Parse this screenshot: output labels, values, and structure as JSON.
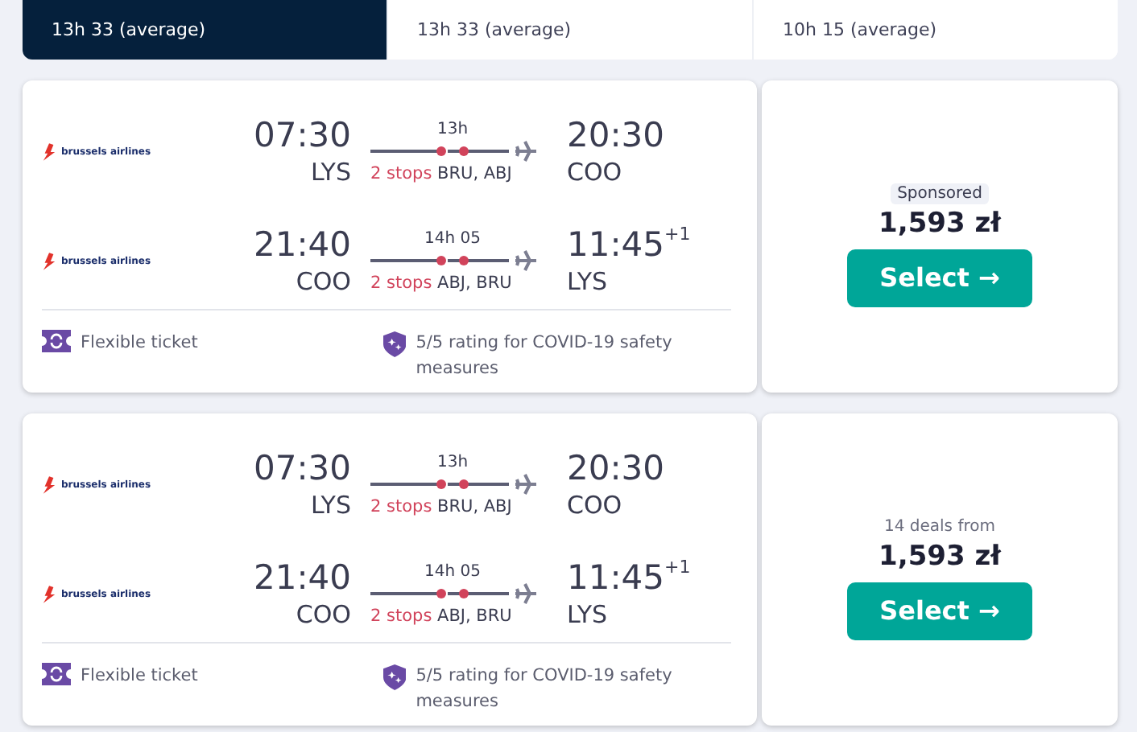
{
  "tabs": [
    {
      "label": "13h 33 (average)",
      "selected": true
    },
    {
      "label": "13h 33 (average)",
      "selected": false
    },
    {
      "label": "10h 15 (average)",
      "selected": false
    }
  ],
  "results": [
    {
      "legs": [
        {
          "airline": "brussels airlines",
          "depart_time": "07:30",
          "depart_airport": "LYS",
          "duration": "13h",
          "stops": "2 stops",
          "via": "BRU, ABJ",
          "arrive_time": "20:30",
          "arrive_airport": "COO"
        },
        {
          "airline": "brussels airlines",
          "depart_time": "21:40",
          "depart_airport": "COO",
          "duration": "14h 05",
          "stops": "2 stops",
          "via": "ABJ, BRU",
          "arrive_time": "11:45",
          "day_offset": "+1",
          "arrive_airport": "LYS"
        }
      ],
      "features": [
        {
          "kind": "flexible",
          "text": "Flexible ticket"
        },
        {
          "kind": "covid",
          "text": "5/5 rating for COVID-19 safety measures"
        }
      ],
      "price_note": {
        "kind": "sponsored",
        "text": "Sponsored"
      },
      "price": "1,593 zł",
      "button": "Select →"
    },
    {
      "legs": [
        {
          "airline": "brussels airlines",
          "depart_time": "07:30",
          "depart_airport": "LYS",
          "duration": "13h",
          "stops": "2 stops",
          "via": "BRU, ABJ",
          "arrive_time": "20:30",
          "arrive_airport": "COO"
        },
        {
          "airline": "brussels airlines",
          "depart_time": "21:40",
          "depart_airport": "COO",
          "duration": "14h 05",
          "stops": "2 stops",
          "via": "ABJ, BRU",
          "arrive_time": "11:45",
          "day_offset": "+1",
          "arrive_airport": "LYS"
        }
      ],
      "features": [
        {
          "kind": "flexible",
          "text": "Flexible ticket"
        },
        {
          "kind": "covid",
          "text": "5/5 rating for COVID-19 safety measures"
        }
      ],
      "price_note": {
        "kind": "deals",
        "text": "14 deals from"
      },
      "price": "1,593 zł",
      "button": "Select →"
    }
  ]
}
